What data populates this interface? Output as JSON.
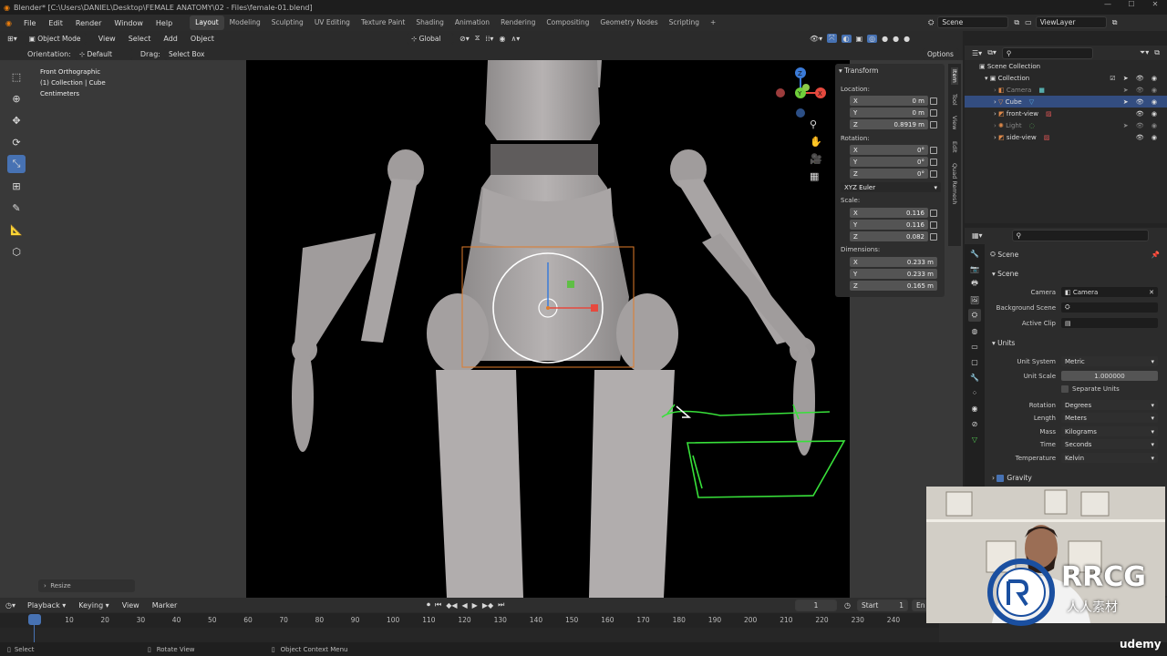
{
  "titlebar": {
    "title": "Blender* [C:\\Users\\DANIEL\\Desktop\\FEMALE ANATOMY\\02 - Files\\female-01.blend]"
  },
  "menubar": {
    "menus": [
      "File",
      "Edit",
      "Render",
      "Window",
      "Help"
    ],
    "workspaces": [
      "Layout",
      "Modeling",
      "Sculpting",
      "UV Editing",
      "Texture Paint",
      "Shading",
      "Animation",
      "Rendering",
      "Compositing",
      "Geometry Nodes",
      "Scripting"
    ],
    "active_workspace": "Layout",
    "add_tab": "+",
    "scene": "Scene",
    "view_layer": "ViewLayer"
  },
  "header3d": {
    "mode": "Object Mode",
    "view": "View",
    "select": "Select",
    "add": "Add",
    "object": "Object",
    "transform_orientation": "Global"
  },
  "tool_settings": {
    "orientation_label": "Orientation:",
    "orientation_value": "Default",
    "drag_label": "Drag:",
    "drag_value": "Select Box",
    "options": "Options"
  },
  "viewport": {
    "view_name": "Front Orthographic",
    "collection_info": "(1) Collection | Cube",
    "units": "Centimeters",
    "last_op": "Resize",
    "gizmo_axes": {
      "z": "Z",
      "y": "Y",
      "x": "X"
    }
  },
  "npanel": {
    "title": "Transform",
    "location_label": "Location:",
    "location": [
      {
        "axis": "X",
        "value": "0 m"
      },
      {
        "axis": "Y",
        "value": "0 m"
      },
      {
        "axis": "Z",
        "value": "0.8919 m"
      }
    ],
    "rotation_label": "Rotation:",
    "rotation": [
      {
        "axis": "X",
        "value": "0°"
      },
      {
        "axis": "Y",
        "value": "0°"
      },
      {
        "axis": "Z",
        "value": "0°"
      }
    ],
    "rotation_mode": "XYZ Euler",
    "scale_label": "Scale:",
    "scale": [
      {
        "axis": "X",
        "value": "0.116"
      },
      {
        "axis": "Y",
        "value": "0.116"
      },
      {
        "axis": "Z",
        "value": "0.082"
      }
    ],
    "dimensions_label": "Dimensions:",
    "dimensions": [
      {
        "axis": "X",
        "value": "0.233 m"
      },
      {
        "axis": "Y",
        "value": "0.233 m"
      },
      {
        "axis": "Z",
        "value": "0.165 m"
      }
    ],
    "tabs": [
      "Item",
      "Tool",
      "View",
      "Edit",
      "Quad Remesh"
    ]
  },
  "outliner": {
    "root": "Scene Collection",
    "collection": "Collection",
    "items": [
      {
        "name": "Camera",
        "color": "#e08a4a",
        "dim": true
      },
      {
        "name": "Cube",
        "color": "#e08a4a",
        "dim": false
      },
      {
        "name": "front-view",
        "color": "#e08a4a",
        "dim": false
      },
      {
        "name": "Light",
        "color": "#e08a4a",
        "dim": true
      },
      {
        "name": "side-view",
        "color": "#e08a4a",
        "dim": false
      }
    ]
  },
  "properties": {
    "breadcrumb": "Scene",
    "scene_section": "Scene",
    "camera_label": "Camera",
    "camera_value": "Camera",
    "bg_scene_label": "Background Scene",
    "active_clip_label": "Active Clip",
    "units_section": "Units",
    "unit_system_label": "Unit System",
    "unit_system_value": "Metric",
    "unit_scale_label": "Unit Scale",
    "unit_scale_value": "1.000000",
    "separate_units": "Separate Units",
    "rotation_label": "Rotation",
    "rotation_value": "Degrees",
    "length_label": "Length",
    "length_value": "Meters",
    "mass_label": "Mass",
    "mass_value": "Kilograms",
    "time_label": "Time",
    "time_value": "Seconds",
    "temperature_label": "Temperature",
    "temperature_value": "Kelvin",
    "gravity_section": "Gravity"
  },
  "timeline": {
    "playback": "Playback",
    "keying": "Keying",
    "view": "View",
    "marker": "Marker",
    "current_frame": "1",
    "start_label": "Start",
    "start_value": "1",
    "end_label": "En",
    "ticks": [
      "1",
      "10",
      "20",
      "30",
      "40",
      "50",
      "60",
      "70",
      "80",
      "90",
      "100",
      "110",
      "120",
      "130",
      "140",
      "150",
      "160",
      "170",
      "180",
      "190",
      "200",
      "210",
      "220",
      "230",
      "240"
    ]
  },
  "statusbar": {
    "select": "Select",
    "rotate": "Rotate View",
    "context": "Object Context Menu"
  },
  "watermark": {
    "brand": "RRCG",
    "sub": "人人素材",
    "udemy": "udemy"
  }
}
